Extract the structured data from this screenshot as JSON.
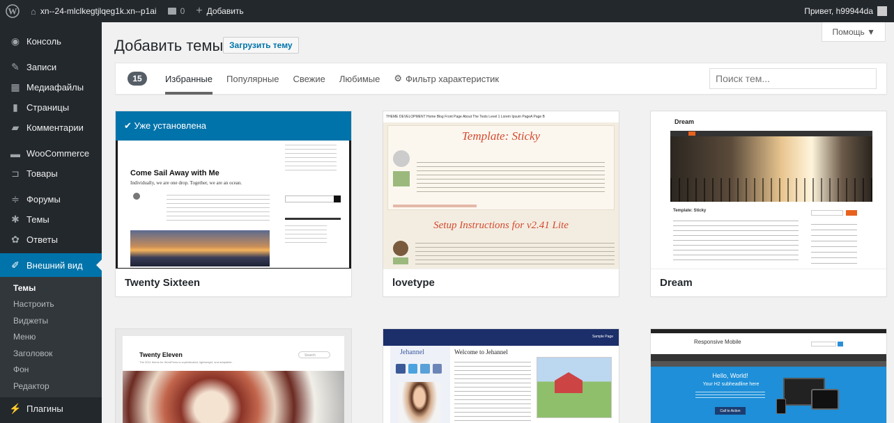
{
  "adminbar": {
    "site_name": "xn--24-mlclkegtjlqeg1k.xn--p1ai",
    "comments_count": "0",
    "add_label": "Добавить",
    "greeting": "Привет, h99944da"
  },
  "sidebar": {
    "items": [
      {
        "label": "Консоль",
        "icon": "dashboard-icon"
      },
      {
        "label": "Записи",
        "icon": "pin-icon"
      },
      {
        "label": "Медиафайлы",
        "icon": "media-icon"
      },
      {
        "label": "Страницы",
        "icon": "page-icon"
      },
      {
        "label": "Комментарии",
        "icon": "comment-icon"
      },
      {
        "label": "WooCommerce",
        "icon": "woocommerce-icon"
      },
      {
        "label": "Товары",
        "icon": "cart-icon"
      },
      {
        "label": "Форумы",
        "icon": "forum-icon"
      },
      {
        "label": "Темы",
        "icon": "topics-icon"
      },
      {
        "label": "Ответы",
        "icon": "replies-icon"
      },
      {
        "label": "Внешний вид",
        "icon": "brush-icon"
      }
    ],
    "submenu": [
      "Темы",
      "Настроить",
      "Виджеты",
      "Меню",
      "Заголовок",
      "Фон",
      "Редактор"
    ],
    "plugins_label": "Плагины"
  },
  "main": {
    "help_label": "Помощь ▼",
    "title": "Добавить темы",
    "upload_label": "Загрузить тему",
    "count": "15",
    "tabs": [
      "Избранные",
      "Популярные",
      "Свежие",
      "Любимые"
    ],
    "feature_filter_label": "Фильтр характеристик",
    "search_placeholder": "Поиск тем..."
  },
  "themes": [
    {
      "name": "Twenty Sixteen",
      "installed_label": "✔ Уже установлена",
      "preview_title": "Come Sail Away with Me",
      "preview_tagline": "Individually, we are one drop. Together, we are an ocean."
    },
    {
      "name": "lovetype",
      "preview_title": "Template: Sticky",
      "preview_subtitle": "Setup Instructions for v2.41 Lite",
      "preview_nav": "THEME DEVELOPMENT  Home  Blog  Front Page  About The Tests  Level 1  Lorem Ipsum  PageA  Page B"
    },
    {
      "name": "Dream",
      "preview_logo": "Dream",
      "preview_post_title": "Template: Sticky"
    },
    {
      "name": "Twenty Eleven",
      "preview_title": "Twenty Eleven",
      "preview_tagline": "The 2011 theme for WordPress is sophisticated, lightweight, and adaptable.",
      "preview_search": "Search"
    },
    {
      "name": "jehannel",
      "preview_logo": "Jehannel",
      "preview_title": "Welcome to Jehannel",
      "preview_top": "Sample Page"
    },
    {
      "name": "Responsive Mobile",
      "preview_logo": "Responsive Mobile",
      "preview_hello": "Hello, World!",
      "preview_sub": "Your H2 subheadline here",
      "preview_btn": "Call to Action"
    }
  ],
  "colors": {
    "accent": "#0073aa",
    "admin_dark": "#23282d",
    "submenu_bg": "#32373c",
    "dream_orange": "#e8621d",
    "lovetype_red": "#d4492f"
  }
}
